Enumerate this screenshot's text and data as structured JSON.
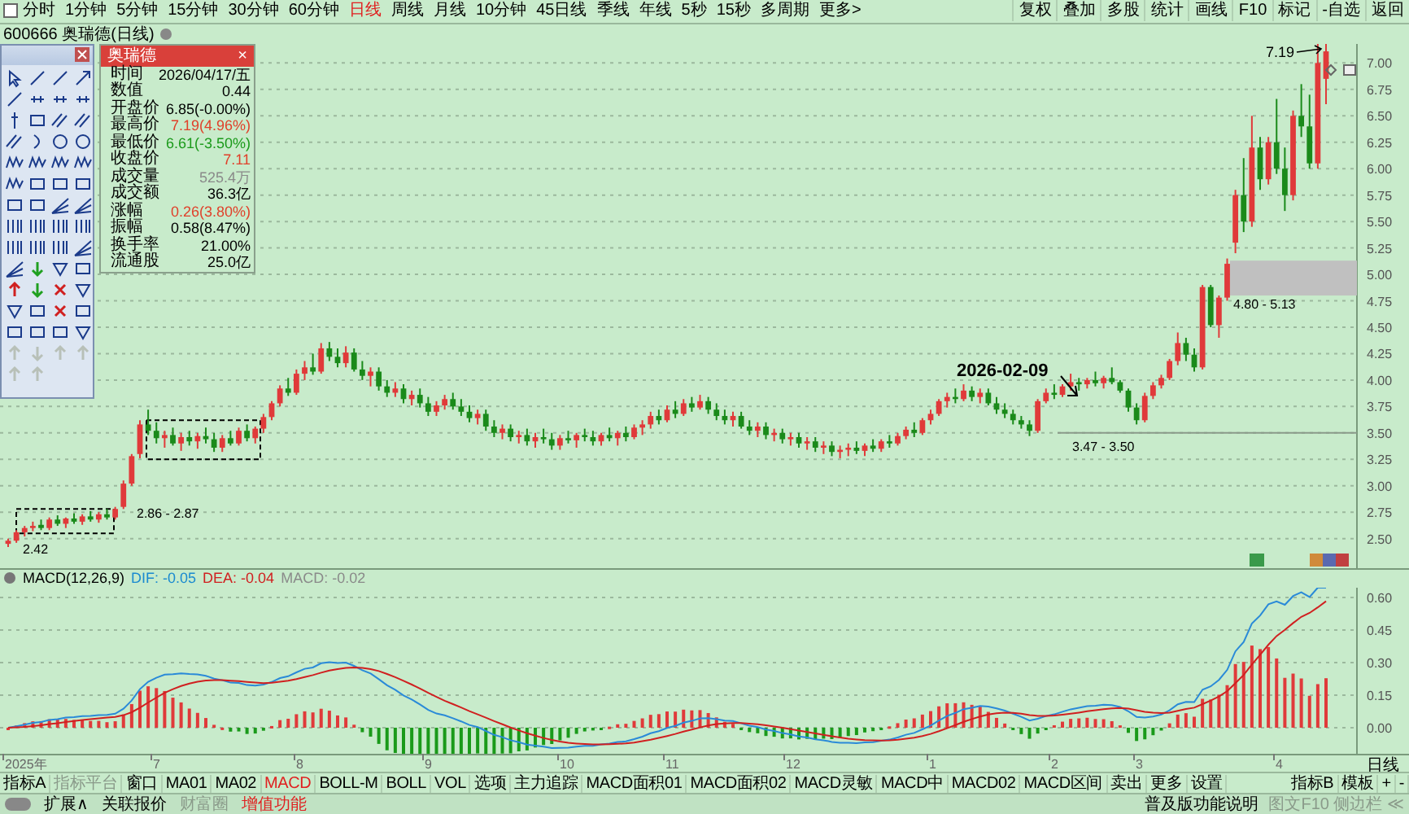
{
  "top_menu": {
    "left": [
      {
        "label": "分时",
        "selected": false
      },
      {
        "label": "1分钟",
        "selected": false
      },
      {
        "label": "5分钟",
        "selected": false
      },
      {
        "label": "15分钟",
        "selected": false
      },
      {
        "label": "30分钟",
        "selected": false
      },
      {
        "label": "60分钟",
        "selected": false
      },
      {
        "label": "日线",
        "selected": true
      },
      {
        "label": "周线",
        "selected": false
      },
      {
        "label": "月线",
        "selected": false
      },
      {
        "label": "10分钟",
        "selected": false
      },
      {
        "label": "45日线",
        "selected": false
      },
      {
        "label": "季线",
        "selected": false
      },
      {
        "label": "年线",
        "selected": false
      },
      {
        "label": "5秒",
        "selected": false
      },
      {
        "label": "15秒",
        "selected": false
      },
      {
        "label": "多周期",
        "selected": false
      },
      {
        "label": "更多>",
        "selected": false
      }
    ],
    "right": [
      "复权",
      "叠加",
      "多股",
      "统计",
      "画线",
      "F10",
      "标记",
      "-自选",
      "返回"
    ]
  },
  "chart_title": "600666 奥瑞德(日线)",
  "info_panel": {
    "title": "奥瑞德",
    "close": "×",
    "rows": [
      {
        "label": "时间",
        "value": "2026/04/17/五",
        "color": "#000000"
      },
      {
        "label": "数值",
        "value": "0.44",
        "color": "#000000"
      },
      {
        "label": "开盘价",
        "value": "6.85(-0.00%)",
        "color": "#000000"
      },
      {
        "label": "最高价",
        "value": "7.19(4.96%)",
        "color": "#e0402a"
      },
      {
        "label": "最低价",
        "value": "6.61(-3.50%)",
        "color": "#1a9a1a"
      },
      {
        "label": "收盘价",
        "value": "7.11",
        "color": "#e0402a"
      },
      {
        "label": "成交量",
        "value": "525.4万",
        "color": "#8a8a8a"
      },
      {
        "label": "成交额",
        "value": "36.3亿",
        "color": "#000000"
      },
      {
        "label": "涨幅",
        "value": "0.26(3.80%)",
        "color": "#e0402a"
      },
      {
        "label": "振幅",
        "value": "0.58(8.47%)",
        "color": "#000000"
      },
      {
        "label": "换手率",
        "value": "21.00%",
        "color": "#000000"
      },
      {
        "label": "流通股",
        "value": "25.0亿",
        "color": "#000000"
      }
    ]
  },
  "price_chart": {
    "chart_data": {
      "type": "candlestick",
      "ylim": [
        2.22,
        7.18
      ],
      "grid": true,
      "yticks": [
        {
          "value": 7.0,
          "label": "7.00"
        },
        {
          "value": 6.75,
          "label": "6.75"
        },
        {
          "value": 6.5,
          "label": "6.50"
        },
        {
          "value": 6.25,
          "label": "6.25"
        },
        {
          "value": 6.0,
          "label": "6.00"
        },
        {
          "value": 5.75,
          "label": "5.75"
        },
        {
          "value": 5.5,
          "label": "5.50"
        },
        {
          "value": 5.25,
          "label": "5.25"
        },
        {
          "value": 5.0,
          "label": "5.00"
        },
        {
          "value": 4.75,
          "label": "4.75"
        },
        {
          "value": 4.5,
          "label": "4.50"
        },
        {
          "value": 4.25,
          "label": "4.25"
        },
        {
          "value": 4.0,
          "label": "4.00"
        },
        {
          "value": 3.75,
          "label": "3.75"
        },
        {
          "value": 3.5,
          "label": "3.50"
        },
        {
          "value": 3.25,
          "label": "3.25"
        },
        {
          "value": 3.0,
          "label": "3.00"
        },
        {
          "value": 2.75,
          "label": "2.75"
        },
        {
          "value": 2.5,
          "label": "2.50"
        }
      ],
      "ohlc": [
        [
          2.45,
          2.5,
          2.42,
          2.48
        ],
        [
          2.48,
          2.58,
          2.46,
          2.56
        ],
        [
          2.56,
          2.62,
          2.52,
          2.6
        ],
        [
          2.6,
          2.66,
          2.57,
          2.62
        ],
        [
          2.63,
          2.68,
          2.58,
          2.6
        ],
        [
          2.6,
          2.7,
          2.58,
          2.68
        ],
        [
          2.68,
          2.72,
          2.62,
          2.64
        ],
        [
          2.64,
          2.7,
          2.6,
          2.69
        ],
        [
          2.69,
          2.74,
          2.64,
          2.66
        ],
        [
          2.66,
          2.73,
          2.63,
          2.71
        ],
        [
          2.71,
          2.76,
          2.66,
          2.68
        ],
        [
          2.68,
          2.75,
          2.65,
          2.73
        ],
        [
          2.73,
          2.78,
          2.68,
          2.7
        ],
        [
          2.7,
          2.8,
          2.68,
          2.78
        ],
        [
          2.8,
          3.05,
          2.78,
          3.02
        ],
        [
          3.02,
          3.3,
          3.0,
          3.28
        ],
        [
          3.3,
          3.62,
          3.26,
          3.58
        ],
        [
          3.58,
          3.72,
          3.48,
          3.52
        ],
        [
          3.52,
          3.6,
          3.4,
          3.45
        ],
        [
          3.45,
          3.52,
          3.36,
          3.48
        ],
        [
          3.48,
          3.55,
          3.38,
          3.4
        ],
        [
          3.4,
          3.5,
          3.33,
          3.46
        ],
        [
          3.46,
          3.52,
          3.38,
          3.42
        ],
        [
          3.42,
          3.5,
          3.35,
          3.47
        ],
        [
          3.47,
          3.55,
          3.4,
          3.44
        ],
        [
          3.44,
          3.5,
          3.32,
          3.36
        ],
        [
          3.36,
          3.48,
          3.32,
          3.45
        ],
        [
          3.45,
          3.52,
          3.38,
          3.4
        ],
        [
          3.4,
          3.55,
          3.38,
          3.52
        ],
        [
          3.52,
          3.58,
          3.42,
          3.45
        ],
        [
          3.45,
          3.56,
          3.4,
          3.54
        ],
        [
          3.54,
          3.68,
          3.5,
          3.65
        ],
        [
          3.65,
          3.8,
          3.62,
          3.78
        ],
        [
          3.78,
          3.95,
          3.75,
          3.92
        ],
        [
          3.92,
          4.02,
          3.85,
          3.88
        ],
        [
          3.88,
          4.1,
          3.86,
          4.06
        ],
        [
          4.06,
          4.18,
          4.0,
          4.12
        ],
        [
          4.12,
          4.25,
          4.05,
          4.08
        ],
        [
          4.08,
          4.35,
          4.06,
          4.3
        ],
        [
          4.3,
          4.36,
          4.18,
          4.22
        ],
        [
          4.22,
          4.3,
          4.12,
          4.16
        ],
        [
          4.16,
          4.32,
          4.12,
          4.26
        ],
        [
          4.26,
          4.3,
          4.08,
          4.1
        ],
        [
          4.1,
          4.18,
          4.0,
          4.04
        ],
        [
          4.04,
          4.12,
          3.94,
          4.08
        ],
        [
          4.08,
          4.12,
          3.9,
          3.94
        ],
        [
          3.94,
          4.0,
          3.84,
          3.88
        ],
        [
          3.88,
          3.98,
          3.84,
          3.92
        ],
        [
          3.92,
          3.96,
          3.78,
          3.82
        ],
        [
          3.82,
          3.9,
          3.76,
          3.86
        ],
        [
          3.86,
          3.92,
          3.74,
          3.78
        ],
        [
          3.78,
          3.84,
          3.66,
          3.7
        ],
        [
          3.7,
          3.8,
          3.66,
          3.76
        ],
        [
          3.76,
          3.86,
          3.72,
          3.82
        ],
        [
          3.82,
          3.88,
          3.72,
          3.75
        ],
        [
          3.75,
          3.82,
          3.66,
          3.7
        ],
        [
          3.7,
          3.76,
          3.6,
          3.64
        ],
        [
          3.64,
          3.72,
          3.58,
          3.68
        ],
        [
          3.68,
          3.72,
          3.52,
          3.56
        ],
        [
          3.56,
          3.62,
          3.46,
          3.5
        ],
        [
          3.5,
          3.58,
          3.44,
          3.54
        ],
        [
          3.54,
          3.58,
          3.42,
          3.46
        ],
        [
          3.46,
          3.52,
          3.4,
          3.48
        ],
        [
          3.48,
          3.54,
          3.38,
          3.42
        ],
        [
          3.42,
          3.5,
          3.36,
          3.46
        ],
        [
          3.46,
          3.54,
          3.4,
          3.44
        ],
        [
          3.44,
          3.5,
          3.34,
          3.38
        ],
        [
          3.38,
          3.48,
          3.34,
          3.45
        ],
        [
          3.45,
          3.52,
          3.4,
          3.43
        ],
        [
          3.43,
          3.5,
          3.36,
          3.48
        ],
        [
          3.48,
          3.54,
          3.42,
          3.46
        ],
        [
          3.46,
          3.52,
          3.38,
          3.42
        ],
        [
          3.42,
          3.5,
          3.38,
          3.48
        ],
        [
          3.48,
          3.55,
          3.42,
          3.45
        ],
        [
          3.45,
          3.52,
          3.38,
          3.5
        ],
        [
          3.5,
          3.56,
          3.42,
          3.46
        ],
        [
          3.46,
          3.58,
          3.44,
          3.55
        ],
        [
          3.55,
          3.62,
          3.48,
          3.58
        ],
        [
          3.58,
          3.7,
          3.54,
          3.66
        ],
        [
          3.66,
          3.72,
          3.58,
          3.62
        ],
        [
          3.62,
          3.76,
          3.6,
          3.72
        ],
        [
          3.72,
          3.8,
          3.64,
          3.68
        ],
        [
          3.68,
          3.82,
          3.66,
          3.78
        ],
        [
          3.78,
          3.84,
          3.7,
          3.74
        ],
        [
          3.74,
          3.86,
          3.72,
          3.8
        ],
        [
          3.8,
          3.84,
          3.68,
          3.72
        ],
        [
          3.72,
          3.78,
          3.62,
          3.66
        ],
        [
          3.66,
          3.72,
          3.58,
          3.62
        ],
        [
          3.62,
          3.7,
          3.56,
          3.66
        ],
        [
          3.66,
          3.7,
          3.54,
          3.56
        ],
        [
          3.56,
          3.62,
          3.48,
          3.52
        ],
        [
          3.52,
          3.6,
          3.46,
          3.56
        ],
        [
          3.56,
          3.6,
          3.44,
          3.48
        ],
        [
          3.48,
          3.54,
          3.42,
          3.5
        ],
        [
          3.5,
          3.54,
          3.4,
          3.44
        ],
        [
          3.44,
          3.5,
          3.38,
          3.46
        ],
        [
          3.46,
          3.5,
          3.36,
          3.4
        ],
        [
          3.4,
          3.46,
          3.34,
          3.42
        ],
        [
          3.42,
          3.46,
          3.32,
          3.36
        ],
        [
          3.36,
          3.42,
          3.3,
          3.38
        ],
        [
          3.38,
          3.42,
          3.28,
          3.32
        ],
        [
          3.32,
          3.38,
          3.26,
          3.34
        ],
        [
          3.34,
          3.4,
          3.28,
          3.36
        ],
        [
          3.36,
          3.42,
          3.3,
          3.33
        ],
        [
          3.33,
          3.4,
          3.28,
          3.38
        ],
        [
          3.38,
          3.44,
          3.32,
          3.35
        ],
        [
          3.35,
          3.44,
          3.32,
          3.42
        ],
        [
          3.42,
          3.48,
          3.36,
          3.4
        ],
        [
          3.4,
          3.5,
          3.38,
          3.47
        ],
        [
          3.47,
          3.56,
          3.44,
          3.53
        ],
        [
          3.53,
          3.6,
          3.46,
          3.5
        ],
        [
          3.5,
          3.64,
          3.48,
          3.62
        ],
        [
          3.62,
          3.72,
          3.58,
          3.68
        ],
        [
          3.68,
          3.82,
          3.66,
          3.8
        ],
        [
          3.8,
          3.88,
          3.74,
          3.84
        ],
        [
          3.84,
          3.92,
          3.78,
          3.82
        ],
        [
          3.82,
          3.96,
          3.8,
          3.9
        ],
        [
          3.9,
          3.94,
          3.8,
          3.84
        ],
        [
          3.84,
          3.92,
          3.78,
          3.88
        ],
        [
          3.88,
          3.92,
          3.76,
          3.78
        ],
        [
          3.78,
          3.84,
          3.68,
          3.72
        ],
        [
          3.72,
          3.78,
          3.64,
          3.68
        ],
        [
          3.68,
          3.72,
          3.58,
          3.62
        ],
        [
          3.62,
          3.66,
          3.54,
          3.58
        ],
        [
          3.58,
          3.62,
          3.47,
          3.52
        ],
        [
          3.52,
          3.82,
          3.5,
          3.8
        ],
        [
          3.8,
          3.92,
          3.78,
          3.88
        ],
        [
          3.88,
          3.96,
          3.82,
          3.86
        ],
        [
          3.86,
          3.96,
          3.84,
          3.94
        ],
        [
          3.94,
          4.06,
          3.9,
          3.98
        ],
        [
          3.98,
          4.02,
          3.9,
          3.96
        ],
        [
          3.96,
          4.02,
          3.92,
          4.0
        ],
        [
          4.0,
          4.08,
          3.94,
          3.97
        ],
        [
          3.97,
          4.04,
          3.92,
          4.02
        ],
        [
          4.02,
          4.12,
          3.96,
          3.98
        ],
        [
          3.98,
          4.0,
          3.88,
          3.9
        ],
        [
          3.9,
          3.92,
          3.7,
          3.74
        ],
        [
          3.74,
          3.78,
          3.58,
          3.62
        ],
        [
          3.62,
          3.88,
          3.6,
          3.85
        ],
        [
          3.85,
          3.98,
          3.82,
          3.95
        ],
        [
          3.95,
          4.05,
          3.92,
          4.02
        ],
        [
          4.02,
          4.2,
          4.0,
          4.18
        ],
        [
          4.18,
          4.45,
          4.14,
          4.35
        ],
        [
          4.35,
          4.4,
          4.18,
          4.24
        ],
        [
          4.24,
          4.3,
          4.08,
          4.12
        ],
        [
          4.12,
          4.9,
          4.1,
          4.88
        ],
        [
          4.88,
          4.9,
          4.5,
          4.52
        ],
        [
          4.52,
          4.8,
          4.4,
          4.78
        ],
        [
          4.78,
          5.15,
          4.75,
          5.1
        ],
        [
          5.3,
          5.8,
          5.2,
          5.75
        ],
        [
          5.75,
          6.1,
          5.4,
          5.5
        ],
        [
          5.5,
          6.5,
          5.45,
          6.2
        ],
        [
          6.2,
          6.3,
          5.8,
          5.9
        ],
        [
          5.9,
          6.3,
          5.85,
          6.25
        ],
        [
          6.25,
          6.66,
          5.95,
          6.0
        ],
        [
          6.0,
          6.2,
          5.6,
          5.75
        ],
        [
          5.75,
          6.55,
          5.7,
          6.5
        ],
        [
          6.5,
          6.8,
          6.3,
          6.4
        ],
        [
          6.4,
          6.7,
          6.0,
          6.05
        ],
        [
          6.05,
          7.19,
          6.0,
          7.0
        ],
        [
          6.85,
          7.19,
          6.61,
          7.11
        ]
      ]
    }
  },
  "annotations": [
    {
      "kind": "peak",
      "text": "7.19"
    },
    {
      "kind": "date",
      "text": "2026-02-09"
    },
    {
      "kind": "range",
      "text": "3.47 - 3.50"
    },
    {
      "kind": "zone",
      "text": "4.80 - 5.13"
    },
    {
      "kind": "range",
      "text": "2.86 - 2.87"
    },
    {
      "kind": "low",
      "text": "2.42"
    }
  ],
  "macd_header": [
    {
      "text": "MACD(12,26,9)",
      "color": "#000000"
    },
    {
      "text": "DIF: -0.05",
      "color": "#1a8ad0"
    },
    {
      "text": "DEA: -0.04",
      "color": "#d02020"
    },
    {
      "text": "MACD: -0.02",
      "color": "#8a8a8a"
    }
  ],
  "macd_axis": [
    "0.60",
    "0.45",
    "0.30",
    "0.15",
    "0.00"
  ],
  "time_axis": [
    "2025年",
    "7",
    "8",
    "9",
    "10",
    "11",
    "12",
    "1",
    "2",
    "3",
    "4"
  ],
  "period_label": "日线",
  "indicator_tabs": {
    "start": "指标A",
    "items": [
      {
        "label": "指标平台",
        "selected": false,
        "disabled": true
      },
      {
        "label": "窗口",
        "selected": false,
        "disabled": false
      },
      {
        "label": "MA01",
        "selected": false,
        "disabled": false
      },
      {
        "label": "MA02",
        "selected": false,
        "disabled": false
      },
      {
        "label": "MACD",
        "selected": true,
        "disabled": false
      },
      {
        "label": "BOLL-M",
        "selected": false,
        "disabled": false
      },
      {
        "label": "BOLL",
        "selected": false,
        "disabled": false
      },
      {
        "label": "VOL",
        "selected": false,
        "disabled": false
      },
      {
        "label": "选项",
        "selected": false,
        "disabled": false
      },
      {
        "label": "主力追踪",
        "selected": false,
        "disabled": false
      },
      {
        "label": "MACD面积01",
        "selected": false,
        "disabled": false
      },
      {
        "label": "MACD面积02",
        "selected": false,
        "disabled": false
      },
      {
        "label": "MACD灵敏",
        "selected": false,
        "disabled": false
      },
      {
        "label": "MACD中",
        "selected": false,
        "disabled": false
      },
      {
        "label": "MACD02",
        "selected": false,
        "disabled": false
      },
      {
        "label": "MACD区间",
        "selected": false,
        "disabled": false
      },
      {
        "label": "卖出",
        "selected": false,
        "disabled": false
      },
      {
        "label": "更多",
        "selected": false,
        "disabled": false
      },
      {
        "label": "设置",
        "selected": false,
        "disabled": false
      }
    ],
    "right": [
      "指标B",
      "模板",
      "+",
      "-"
    ]
  },
  "bottom_bar": {
    "toggle_on": false,
    "items": [
      {
        "label": "扩展∧",
        "kind": "normal"
      },
      {
        "label": "关联报价",
        "kind": "normal"
      },
      {
        "label": "财富圈",
        "kind": "muted"
      },
      {
        "label": "增值功能",
        "kind": "highlight"
      }
    ],
    "right": [
      {
        "label": "普及版功能说明",
        "kind": "normal"
      },
      {
        "label": "图文F10 侧边栏 ≪",
        "kind": "muted"
      }
    ]
  }
}
